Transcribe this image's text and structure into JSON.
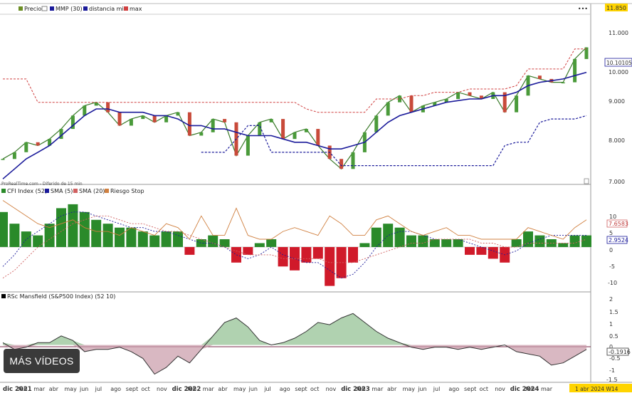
{
  "header": {
    "legend": [
      {
        "label": "Precio",
        "color": "#6b8e23"
      },
      {
        "label": "MMP (30)",
        "color": "#1a1a9a"
      },
      {
        "label": "distancia min",
        "color": "#1a1a9a"
      },
      {
        "label": "max",
        "color": "#d04040"
      }
    ],
    "window_controls": "•••",
    "source_label": "ProRealTime.com - Diferido de 15 min"
  },
  "price_axis": {
    "ticks": [
      "11.000",
      "10.000",
      "9.000",
      "8.000",
      "7.000"
    ],
    "top_value_badge": "11.850",
    "current_value_badge": "10.10105"
  },
  "indicator_panel": {
    "legend": [
      {
        "label": "CFI Index (52)",
        "color": "#2a8a2a"
      },
      {
        "label": "SMA (5)",
        "color": "#1a1a9a"
      },
      {
        "label": "SMA (20)",
        "color": "#d06060"
      },
      {
        "label": "Riesgo Stop",
        "color": "#d08040"
      }
    ],
    "ticks": [
      "10",
      "5",
      "0",
      "-5",
      "-10"
    ],
    "value_badge_1": "7.6583",
    "value_badge_2": "2.9524"
  },
  "rsc_panel": {
    "legend": [
      {
        "label": "RSc Mansfield (S&P500 Index) (52 10)",
        "color": "#000000"
      }
    ],
    "ticks": [
      "2",
      "1.5",
      "1",
      "0.5",
      "0",
      "-0.5",
      "-1",
      "-1.5"
    ],
    "value_badge": "-0.1916"
  },
  "time_axis": {
    "labels": [
      "dic 2021",
      "feb",
      "mar",
      "abr",
      "may",
      "jun",
      "jul",
      "ago",
      "sept",
      "oct",
      "nov",
      "dic 2022",
      "feb",
      "mar",
      "abr",
      "may",
      "jun",
      "jul",
      "ago",
      "sept",
      "oct",
      "nov",
      "dic 2023",
      "feb",
      "mar",
      "abr",
      "may",
      "jun",
      "jul",
      "ago",
      "sept",
      "oct",
      "nov",
      "dic 2024",
      "feb",
      "mar",
      "1 abr 2024 W14"
    ]
  },
  "overlay_button": {
    "label": "MÁS VÍDEOS"
  },
  "chart_data": [
    {
      "type": "line",
      "panel": "price",
      "series_note": "weekly candles approximated by closing values",
      "ylim": [
        6.9,
        11.9
      ],
      "series": [
        {
          "name": "Precio",
          "values": [
            7.6,
            7.8,
            8.1,
            8.0,
            8.2,
            8.5,
            8.9,
            9.2,
            9.3,
            9.0,
            8.6,
            8.8,
            8.9,
            8.7,
            8.9,
            9.0,
            8.3,
            8.4,
            8.8,
            8.7,
            7.7,
            8.3,
            8.7,
            8.8,
            8.2,
            8.4,
            8.5,
            8.0,
            7.6,
            7.3,
            7.8,
            8.4,
            8.9,
            9.3,
            9.5,
            9.0,
            9.2,
            9.3,
            9.4,
            9.6,
            9.5,
            9.4,
            9.6,
            9.0,
            9.5,
            10.1,
            10.0,
            9.9,
            9.9,
            10.6,
            10.95
          ]
        },
        {
          "name": "MMP (30)",
          "values": [
            7.0,
            7.3,
            7.6,
            7.8,
            8.0,
            8.3,
            8.6,
            8.9,
            9.1,
            9.1,
            9.0,
            9.0,
            9.0,
            8.9,
            8.9,
            8.8,
            8.6,
            8.6,
            8.5,
            8.5,
            8.4,
            8.3,
            8.3,
            8.3,
            8.2,
            8.1,
            8.1,
            8.0,
            7.9,
            7.9,
            8.0,
            8.1,
            8.4,
            8.7,
            8.9,
            9.0,
            9.1,
            9.2,
            9.3,
            9.35,
            9.4,
            9.4,
            9.5,
            9.5,
            9.6,
            9.8,
            9.9,
            9.95,
            10.0,
            10.1,
            10.2
          ]
        },
        {
          "name": "max",
          "values": [
            10.0,
            10.0,
            10.0,
            9.3,
            9.3,
            9.3,
            9.3,
            9.3,
            9.3,
            9.3,
            9.3,
            9.3,
            9.3,
            9.3,
            9.3,
            9.3,
            9.3,
            9.3,
            9.3,
            9.3,
            9.3,
            9.3,
            9.3,
            9.3,
            9.3,
            9.3,
            9.1,
            9.0,
            9.0,
            9.0,
            9.0,
            9.0,
            9.4,
            9.4,
            9.4,
            9.5,
            9.5,
            9.6,
            9.6,
            9.6,
            9.7,
            9.7,
            9.7,
            9.7,
            9.8,
            10.3,
            10.3,
            10.3,
            10.3,
            10.9,
            10.9
          ]
        },
        {
          "name": "distancia min",
          "values": [
            null,
            null,
            null,
            null,
            null,
            null,
            null,
            null,
            null,
            null,
            null,
            null,
            null,
            null,
            null,
            null,
            null,
            7.8,
            7.8,
            7.8,
            8.2,
            8.6,
            8.6,
            7.8,
            7.8,
            7.8,
            7.8,
            7.8,
            7.8,
            7.4,
            7.4,
            7.4,
            7.4,
            7.4,
            7.4,
            7.4,
            7.4,
            7.4,
            7.4,
            7.4,
            7.4,
            7.4,
            7.4,
            8.0,
            8.1,
            8.1,
            8.7,
            8.8,
            8.8,
            8.8,
            8.9
          ]
        }
      ]
    },
    {
      "type": "bar",
      "panel": "indicator",
      "ylim": [
        -11,
        13
      ],
      "series": [
        {
          "name": "CFI Index (52)",
          "values": [
            9,
            6,
            4,
            3,
            6,
            10,
            11,
            9,
            7,
            6,
            5,
            5,
            4,
            3,
            4,
            4,
            -2,
            2,
            3,
            2,
            -4,
            -2,
            1,
            2,
            -5,
            -6,
            -4,
            -3,
            -10,
            -8,
            -4,
            1,
            5,
            6,
            5,
            3,
            3,
            2,
            2,
            2,
            -2,
            -2,
            -3,
            -4,
            2,
            4,
            3,
            2,
            1,
            3,
            3
          ]
        },
        {
          "name": "SMA (5)",
          "values": [
            -5,
            -2,
            2,
            4,
            6,
            8,
            9,
            9,
            8,
            7,
            6,
            5,
            5,
            4,
            4,
            3,
            2,
            1,
            1,
            0,
            -2,
            -3,
            -2,
            0,
            -2,
            -3,
            -4,
            -4,
            -6,
            -8,
            -7,
            -4,
            0,
            3,
            4,
            4,
            3,
            2,
            2,
            2,
            1,
            0,
            -1,
            -2,
            -1,
            1,
            2,
            3,
            3,
            3,
            3
          ]
        },
        {
          "name": "SMA (20)",
          "values": [
            -8,
            -6,
            -3,
            0,
            2,
            4,
            6,
            7,
            8,
            8,
            7,
            6,
            6,
            5,
            4,
            4,
            3,
            2,
            1,
            0,
            -1,
            -2,
            -2,
            -2,
            -3,
            -3,
            -3,
            -3,
            -4,
            -4,
            -4,
            -3,
            -2,
            -1,
            0,
            1,
            1,
            2,
            2,
            2,
            2,
            1,
            1,
            0,
            0,
            1,
            1,
            1,
            1,
            1,
            2
          ]
        },
        {
          "name": "Riesgo Stop",
          "values": [
            12,
            10,
            8,
            6,
            5,
            6,
            7,
            5,
            4,
            4,
            3,
            5,
            4,
            3,
            6,
            5,
            2,
            8,
            3,
            3,
            10,
            3,
            2,
            2,
            4,
            5,
            4,
            3,
            8,
            6,
            3,
            3,
            7,
            8,
            6,
            4,
            3,
            4,
            5,
            3,
            3,
            2,
            2,
            2,
            2,
            5,
            4,
            3,
            2,
            5,
            7
          ]
        }
      ]
    },
    {
      "type": "area",
      "panel": "rsc",
      "ylim": [
        -1.6,
        2.2
      ],
      "series": [
        {
          "name": "RSc Mansfield (S&P500 Index) (52 10)",
          "values": [
            0.1,
            -0.2,
            -0.1,
            0.1,
            0.1,
            0.4,
            0.2,
            -0.3,
            -0.2,
            -0.2,
            -0.1,
            -0.3,
            -0.6,
            -1.3,
            -1.0,
            -0.5,
            -0.8,
            -0.2,
            0.4,
            1.0,
            1.2,
            0.8,
            0.2,
            0.0,
            0.1,
            0.3,
            0.6,
            1.0,
            0.9,
            1.2,
            1.4,
            1.0,
            0.6,
            0.3,
            0.1,
            -0.1,
            -0.2,
            -0.1,
            -0.1,
            -0.2,
            -0.1,
            -0.2,
            -0.1,
            0.0,
            -0.3,
            -0.4,
            -0.5,
            -0.9,
            -0.8,
            -0.5,
            -0.2
          ]
        }
      ]
    }
  ]
}
